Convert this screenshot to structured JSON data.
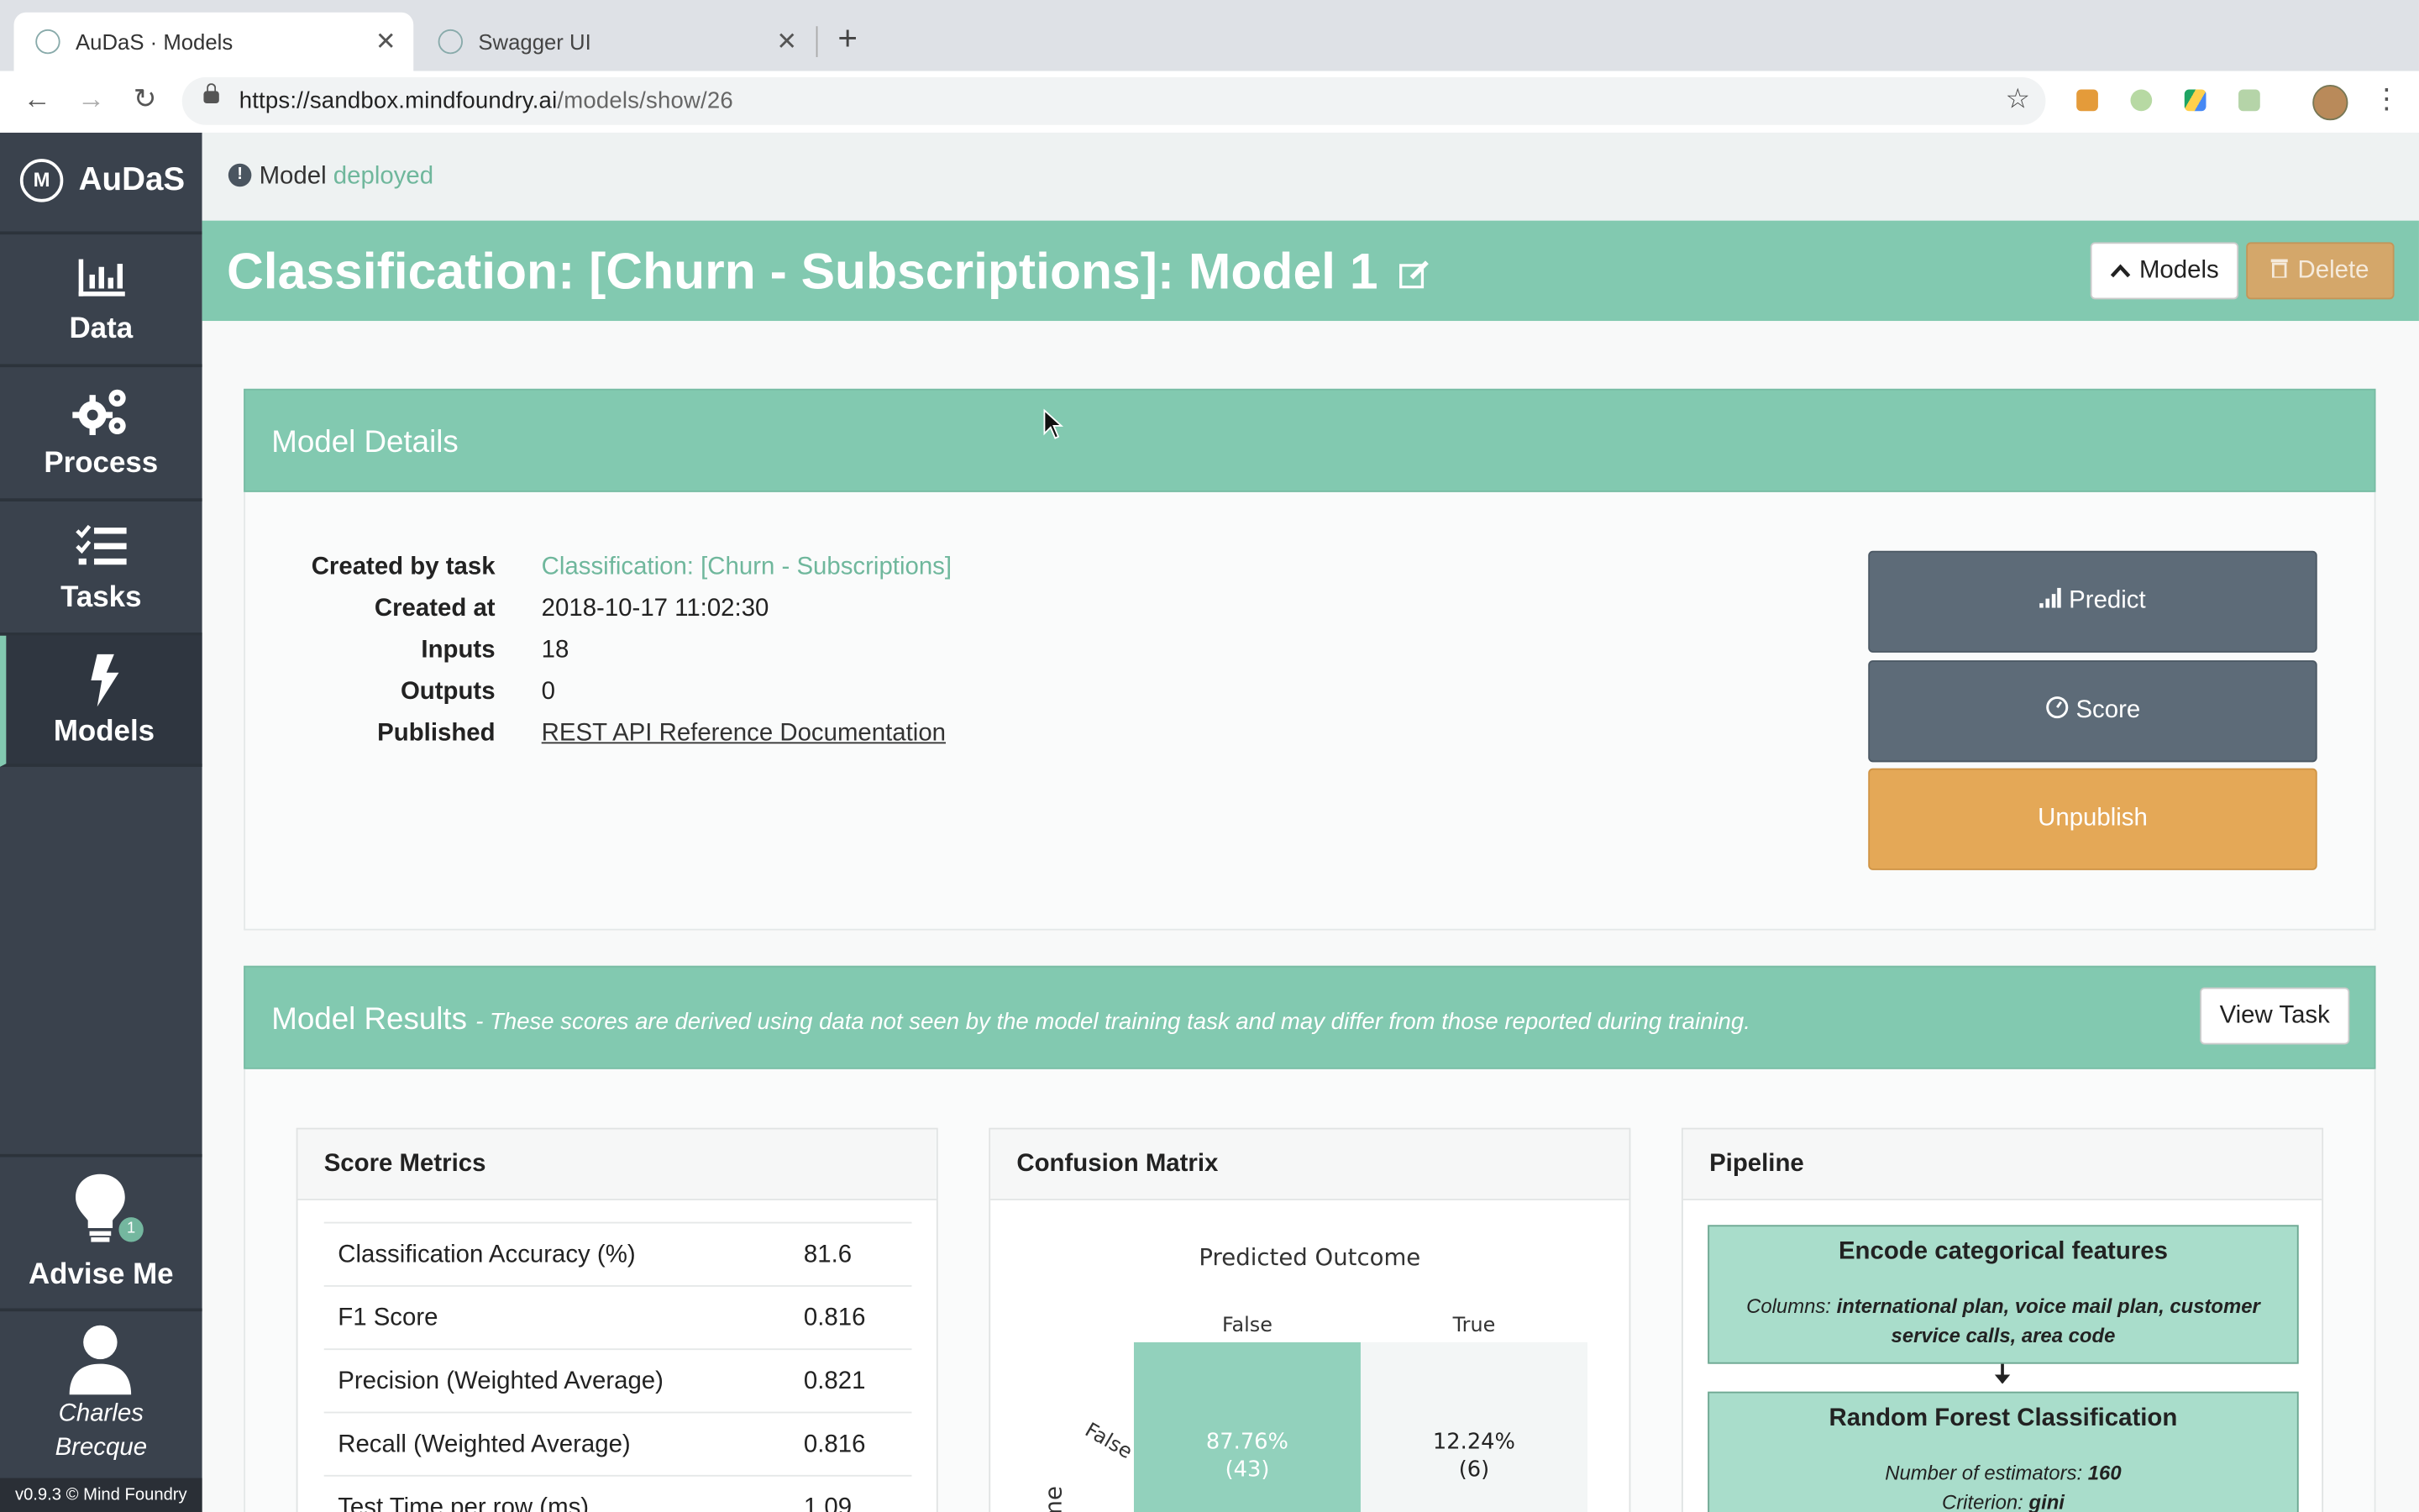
{
  "browser": {
    "tabs": [
      {
        "title": "AuDaS · Models"
      },
      {
        "title": "Swagger UI"
      }
    ],
    "url_host": "https://sandbox.mindfoundry.ai",
    "url_path": "/models/show/26"
  },
  "sidebar": {
    "brand": "AuDaS",
    "brand_logo": "M",
    "items": [
      {
        "label": "Data",
        "icon": "bar-chart-icon"
      },
      {
        "label": "Process",
        "icon": "cogs-icon"
      },
      {
        "label": "Tasks",
        "icon": "tasks-icon"
      },
      {
        "label": "Models",
        "icon": "bolt-icon"
      }
    ],
    "advise_label": "Advise Me",
    "advise_badge": "1",
    "user_first": "Charles",
    "user_last": "Brecque",
    "version": "v0.9.3 © Mind Foundry"
  },
  "notice": {
    "icon_glyph": "!",
    "label": "Model",
    "status": "deployed"
  },
  "header": {
    "title": "Classification: [Churn - Subscriptions]: Model 1",
    "models_button": "Models",
    "delete_button": "Delete"
  },
  "details": {
    "heading": "Model Details",
    "rows": [
      {
        "key": "Created by task",
        "value": "Classification: [Churn - Subscriptions]"
      },
      {
        "key": "Created at",
        "value": "2018-10-17 11:02:30"
      },
      {
        "key": "Inputs",
        "value": "18"
      },
      {
        "key": "Outputs",
        "value": "0"
      },
      {
        "key": "Published",
        "value": "REST API Reference Documentation"
      }
    ],
    "predict_button": "Predict",
    "score_button": "Score",
    "unpublish_button": "Unpublish"
  },
  "results": {
    "heading": "Model Results",
    "note": "- These scores are derived using data not seen by the model training task and may differ from those reported during training.",
    "view_task_button": "View Task"
  },
  "score_metrics": {
    "heading": "Score Metrics",
    "rows": [
      {
        "name": "Classification Accuracy (%)",
        "value": "81.6"
      },
      {
        "name": "F1 Score",
        "value": "0.816"
      },
      {
        "name": "Precision (Weighted Average)",
        "value": "0.821"
      },
      {
        "name": "Recall (Weighted Average)",
        "value": "0.816"
      },
      {
        "name": "Test Time per row (ms)",
        "value": "1.09"
      }
    ]
  },
  "confusion": {
    "heading": "Confusion Matrix",
    "predicted_label": "Predicted Outcome",
    "actual_label_fragment": "me",
    "col_false": "False",
    "col_true": "True",
    "row_false": "False",
    "cells": [
      {
        "pct": "87.76%",
        "count": "(43)",
        "color": "#92d1bc"
      },
      {
        "pct": "12.24%",
        "count": "(6)",
        "color": "#f3f6f6"
      }
    ]
  },
  "pipeline": {
    "heading": "Pipeline",
    "steps": [
      {
        "title": "Encode categorical features",
        "desc_label": "Columns:",
        "desc_value": "international plan, voice mail plan, customer service calls, area code"
      },
      {
        "title": "Random Forest Classification",
        "desc1_label": "Number of estimators:",
        "desc1_value": "160",
        "desc2_label": "Criterion:",
        "desc2_value": "gini"
      }
    ]
  },
  "colors": {
    "accent": "#82c9b0",
    "sidebar": "#3a424d",
    "slate_button": "#5d6b78",
    "orange_button": "#e4a857",
    "delete_button": "#d4a76a"
  }
}
